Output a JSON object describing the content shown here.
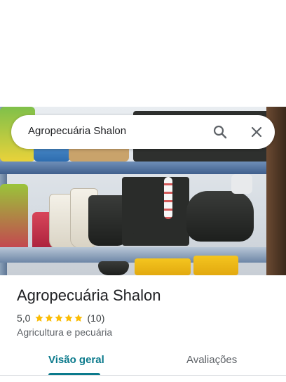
{
  "search": {
    "query": "Agropecuária Shalon"
  },
  "place": {
    "name": "Agropecuária Shalon",
    "rating": "5,0",
    "stars": 5,
    "review_count": "(10)",
    "category": "Agricultura e pecuária"
  },
  "tabs": [
    {
      "label": "Visão geral",
      "active": true
    },
    {
      "label": "Avaliações",
      "active": false
    }
  ],
  "colors": {
    "accent": "#0b7a8c",
    "star": "#fbbc04",
    "text_primary": "#202124",
    "text_secondary": "#5f6368"
  },
  "icons": {
    "search": "search-icon",
    "close": "close-icon",
    "star": "star-icon"
  }
}
